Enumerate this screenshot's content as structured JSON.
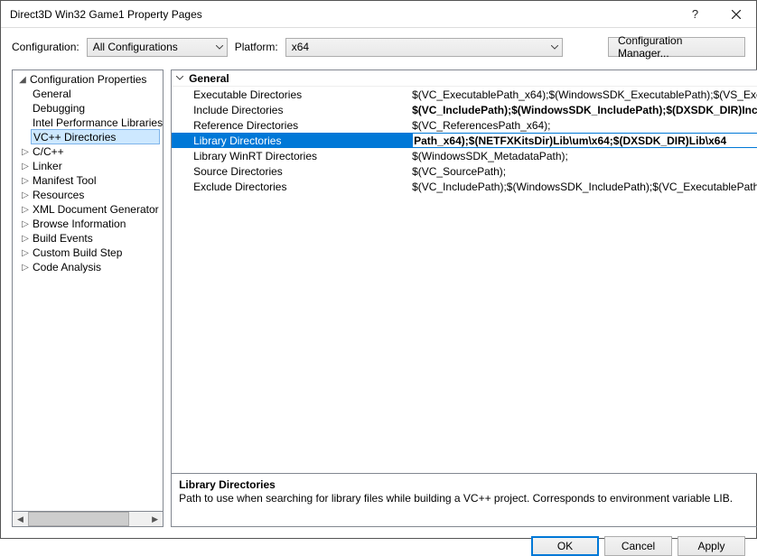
{
  "window": {
    "title": "Direct3D Win32 Game1 Property Pages"
  },
  "topbar": {
    "config_label": "Configuration:",
    "config_value": "All Configurations",
    "platform_label": "Platform:",
    "platform_value": "x64",
    "manager_label": "Configuration Manager..."
  },
  "tree": {
    "root_label": "Configuration Properties",
    "items": [
      {
        "label": "General",
        "glyph": ""
      },
      {
        "label": "Debugging",
        "glyph": ""
      },
      {
        "label": "Intel Performance Libraries",
        "glyph": ""
      },
      {
        "label": "VC++ Directories",
        "glyph": "",
        "selected": true
      },
      {
        "label": "C/C++",
        "glyph": "▷"
      },
      {
        "label": "Linker",
        "glyph": "▷"
      },
      {
        "label": "Manifest Tool",
        "glyph": "▷"
      },
      {
        "label": "Resources",
        "glyph": "▷"
      },
      {
        "label": "XML Document Generator",
        "glyph": "▷"
      },
      {
        "label": "Browse Information",
        "glyph": "▷"
      },
      {
        "label": "Build Events",
        "glyph": "▷"
      },
      {
        "label": "Custom Build Step",
        "glyph": "▷"
      },
      {
        "label": "Code Analysis",
        "glyph": "▷"
      }
    ]
  },
  "grid": {
    "section": "General",
    "rows": [
      {
        "name": "Executable Directories",
        "value": "$(VC_ExecutablePath_x64);$(WindowsSDK_ExecutablePath);$(VS_ExecutablePath)",
        "bold": false
      },
      {
        "name": "Include Directories",
        "value": "$(VC_IncludePath);$(WindowsSDK_IncludePath);$(DXSDK_DIR)Include",
        "bold": true
      },
      {
        "name": "Reference Directories",
        "value": "$(VC_ReferencesPath_x64);",
        "bold": false
      },
      {
        "name": "Library Directories",
        "value": "Path_x64);$(NETFXKitsDir)Lib\\um\\x64;$(DXSDK_DIR)Lib\\x64",
        "bold": true,
        "selected": true
      },
      {
        "name": "Library WinRT Directories",
        "value": "$(WindowsSDK_MetadataPath);",
        "bold": false
      },
      {
        "name": "Source Directories",
        "value": "$(VC_SourcePath);",
        "bold": false
      },
      {
        "name": "Exclude Directories",
        "value": "$(VC_IncludePath);$(WindowsSDK_IncludePath);$(VC_ExecutablePath)",
        "bold": false
      }
    ]
  },
  "description": {
    "title": "Library Directories",
    "text": "Path to use when searching for library files while building a VC++ project.  Corresponds to environment variable LIB."
  },
  "footer": {
    "ok": "OK",
    "cancel": "Cancel",
    "apply": "Apply"
  }
}
